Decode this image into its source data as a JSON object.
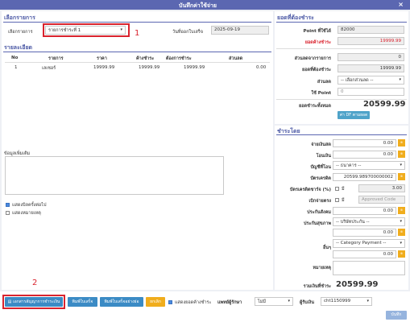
{
  "window": {
    "title": "บันทึกค่าใช้จ่าย",
    "close": "×"
  },
  "select_section": {
    "heading": "เลือกรายการ",
    "item_label": "เลือกรายการ",
    "item_value": "รายการชำระที่ 1",
    "date_label": "วันที่ออกใบเสร็จ",
    "date_value": "2025-09-19"
  },
  "markers": {
    "one": "1",
    "two": "2"
  },
  "details": {
    "heading": "รายละเอียด",
    "columns": [
      "No",
      "รายการ",
      "ราคา",
      "ค้างชำระ",
      "ต้องการชำระ",
      "ส่วนลด"
    ],
    "rows": [
      {
        "no": "1",
        "item": "เลเซอร์",
        "price": "19999.99",
        "outstanding": "19999.99",
        "pay": "19999.99",
        "discount": "0.00"
      }
    ]
  },
  "notes": {
    "label": "ข้อมูลเพิ่มเติม",
    "show_next": "แสดงบิลครั้งต่อไป",
    "show_remark": "แสดงหมายเหตุ"
  },
  "summary": {
    "heading": "ยอดที่ต้องชำระ",
    "point_label": "Point ที่ใช้ได้",
    "point_value": "82000",
    "outstanding_label": "ยอดค้างชำระ",
    "outstanding_value": "19999.99",
    "discount_items_label": "ส่วนลดจากรายการ",
    "discount_items_value": "0",
    "total_due_label": "ยอดที่ต้องชำระ",
    "total_due_value": "19999.99",
    "discount_label": "ส่วนลด",
    "discount_select": "-- เลือกส่วนลด --",
    "use_point_label": "ใช้ Point",
    "use_point_value": "0",
    "net_label": "ยอดชำระทั้งหมด",
    "net_value": "20599.99",
    "df_button": "ค่า DF ตามยอด"
  },
  "payment": {
    "heading": "ชำระโดย",
    "cash_label": "จ่ายเงินสด",
    "cash_value": "0.00",
    "transfer_label": "โอนเงิน",
    "transfer_value": "0.00",
    "account_label": "บัญชีที่โอน",
    "account_select": "-- ธนาคาร --",
    "credit_label": "บัตรเครดิต",
    "credit_value": "20599.989700000002",
    "fee_label": "บัตรเครดิตชาร์จ (%)",
    "fee_check": "มี",
    "fee_value": "3.00",
    "advance_label": "เบิกจ่ายตรง",
    "advance_check": "มี",
    "advance_placeholder": "Approved Code",
    "social_label": "ประกันสังคม",
    "social_value": "0.00",
    "insurance_label": "ประกันสุขภาพ",
    "insurance_select": "-- บริษัทประกัน --",
    "insurance_value": "0.00",
    "other_label": "อื่นๆ",
    "other_select": "-- Category Payment --",
    "other_value": "0.00",
    "remark_label": "หมายเหตุ",
    "total_label": "รวมเงินที่ชำระ",
    "total_value": "20599.99",
    "ob_icon": "๏"
  },
  "footer": {
    "doc_button": "เอกสารสัญญาการชำระเงิน",
    "print_receipt": "พิมพ์ใบเสร็จ",
    "print_short": "พิมพ์ใบเสร็จอย่างย่อ",
    "cancel": "ยกเลิก",
    "show_outstanding": "แสดงยอดค้างชำระ",
    "doctor_label": "แพทย์ผู้รักษา",
    "doctor_select": "ไม่มี",
    "receiver_label": "ผู้รับเงิน",
    "receiver_select": "cht1150999",
    "save": "บันทึก"
  },
  "colors": {
    "header": "#5b67b1",
    "highlight": "#d9232e",
    "orange": "#f0ad1d",
    "save": "#96b4de"
  }
}
